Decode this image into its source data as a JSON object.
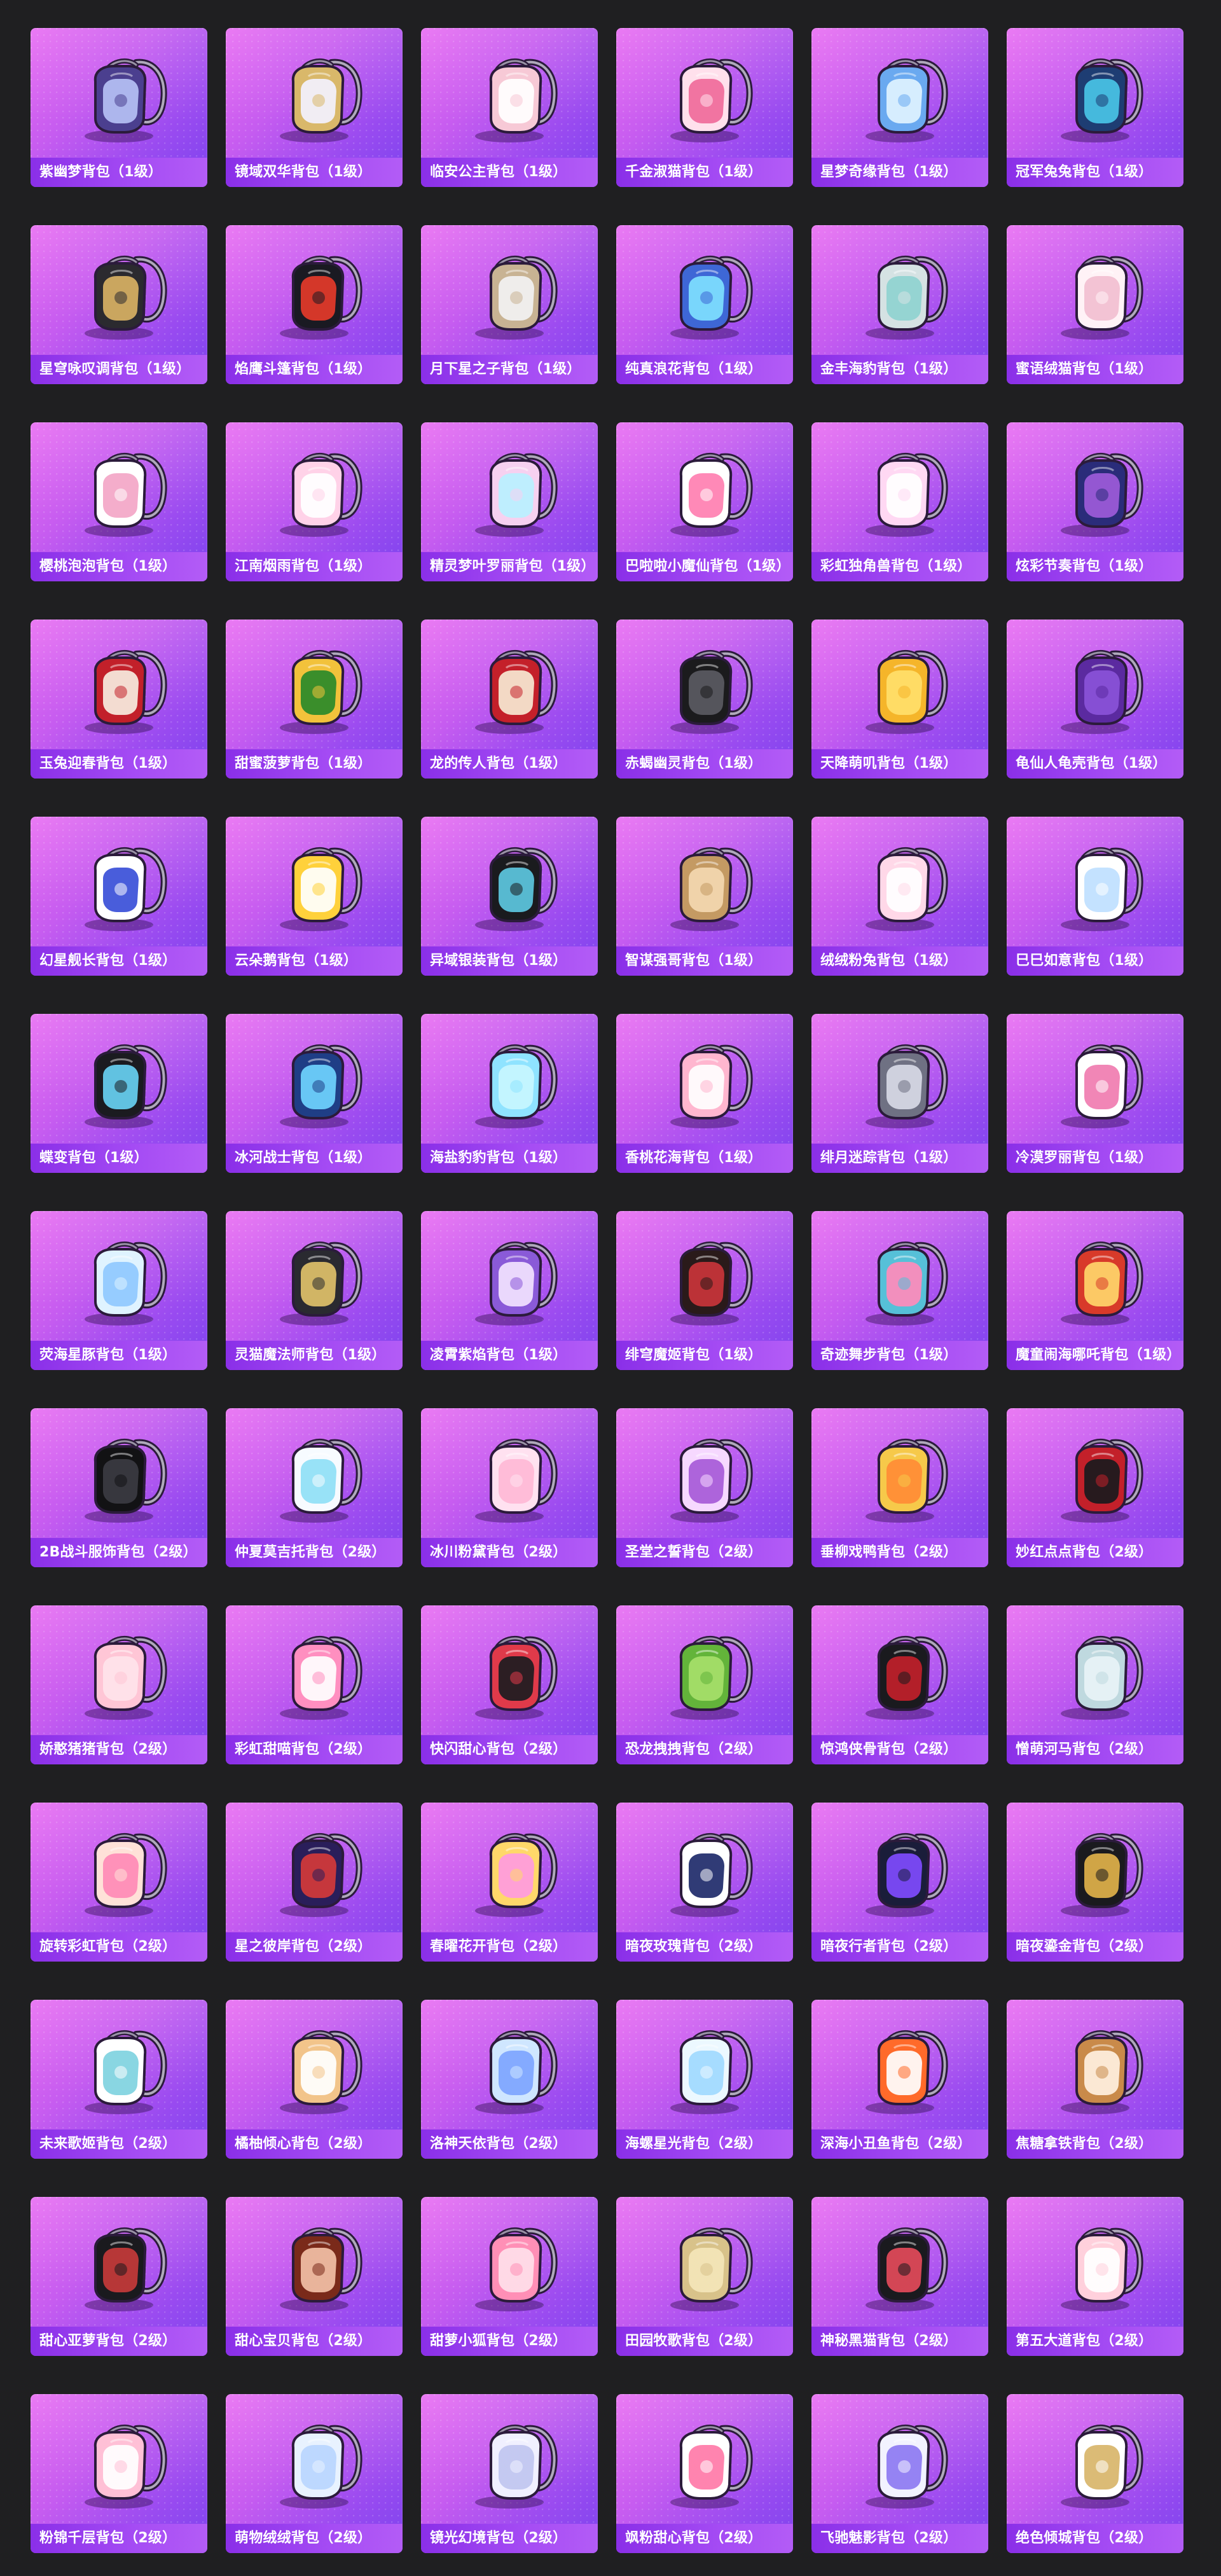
{
  "items": [
    {
      "name": "紫幽梦背包（1级）",
      "colors": [
        "#4b3f8f",
        "#b5c0f5"
      ]
    },
    {
      "name": "镜域双华背包（1级）",
      "colors": [
        "#d9b86a",
        "#f3f1ff"
      ]
    },
    {
      "name": "临安公主背包（1级）",
      "colors": [
        "#f7c9d6",
        "#ffffff"
      ]
    },
    {
      "name": "千金淑猫背包（1级）",
      "colors": [
        "#ffe0ec",
        "#f06a9a"
      ]
    },
    {
      "name": "星梦奇缘背包（1级）",
      "colors": [
        "#6aa9f0",
        "#dff3ff"
      ]
    },
    {
      "name": "冠军兔兔背包（1级）",
      "colors": [
        "#1e3d73",
        "#49c3e6"
      ]
    },
    {
      "name": "星穹咏叹调背包（1级）",
      "colors": [
        "#2b2a2f",
        "#d8b164"
      ]
    },
    {
      "name": "焰鹰斗篷背包（1级）",
      "colors": [
        "#1a1a22",
        "#e43a2a"
      ]
    },
    {
      "name": "月下星之子背包（1级）",
      "colors": [
        "#c8b393",
        "#f2f2f2"
      ]
    },
    {
      "name": "纯真浪花背包（1级）",
      "colors": [
        "#3e67d6",
        "#7ee0ff"
      ]
    },
    {
      "name": "金丰海豹背包（1级）",
      "colors": [
        "#d5e2e3",
        "#8fd3d0"
      ]
    },
    {
      "name": "蜜语绒猫背包（1级）",
      "colors": [
        "#fff2f6",
        "#f2bfd0"
      ]
    },
    {
      "name": "樱桃泡泡背包（1级）",
      "colors": [
        "#ffffff",
        "#f3a6c7"
      ]
    },
    {
      "name": "江南烟雨背包（1级）",
      "colors": [
        "#ffd2e8",
        "#ffffff"
      ]
    },
    {
      "name": "精灵梦叶罗丽背包（1级）",
      "colors": [
        "#f6d1f0",
        "#b9f0ff"
      ]
    },
    {
      "name": "巴啦啦小魔仙背包（1级）",
      "colors": [
        "#ffffff",
        "#ff7fb1"
      ]
    },
    {
      "name": "彩虹独角兽背包（1级）",
      "colors": [
        "#ffd8f3",
        "#ffffff"
      ]
    },
    {
      "name": "炫彩节奏背包（1级）",
      "colors": [
        "#2a2c7a",
        "#9d5bd9"
      ]
    },
    {
      "name": "玉兔迎春背包（1级）",
      "colors": [
        "#c2202a",
        "#f7ede0"
      ]
    },
    {
      "name": "甜蜜菠萝背包（1级）",
      "colors": [
        "#f2c23b",
        "#2a8a2a"
      ]
    },
    {
      "name": "龙的传人背包（1级）",
      "colors": [
        "#c4202a",
        "#f6e9d2"
      ]
    },
    {
      "name": "赤蝎幽灵背包（1级）",
      "colors": [
        "#1b1b1d",
        "#5a5a62"
      ]
    },
    {
      "name": "天降萌叽背包（1级）",
      "colors": [
        "#f5b52a",
        "#ffe06a"
      ]
    },
    {
      "name": "龟仙人龟壳背包（1级）",
      "colors": [
        "#5b2aa0",
        "#8a52d8"
      ]
    },
    {
      "name": "幻星舰长背包（1级）",
      "colors": [
        "#ffffff",
        "#3a4fd8"
      ]
    },
    {
      "name": "云朵鹅背包（1级）",
      "colors": [
        "#ffd13b",
        "#ffffff"
      ]
    },
    {
      "name": "异域银装背包（1级）",
      "colors": [
        "#1a1b1e",
        "#5cc7e0"
      ]
    },
    {
      "name": "智谋强哥背包（1级）",
      "colors": [
        "#c49a63",
        "#f3d8b0"
      ]
    },
    {
      "name": "绒绒粉兔背包（1级）",
      "colors": [
        "#ffd8e8",
        "#ffffff"
      ]
    },
    {
      "name": "巳巳如意背包（1级）",
      "colors": [
        "#ffffff",
        "#bfe0ff"
      ]
    },
    {
      "name": "蝶变背包（1级）",
      "colors": [
        "#1b1b20",
        "#67d0f2"
      ]
    },
    {
      "name": "冰河战士背包（1级）",
      "colors": [
        "#1f3e86",
        "#6fd3ff"
      ]
    },
    {
      "name": "海盐豹豹背包（1级）",
      "colors": [
        "#8fe3ff",
        "#c8f6ff"
      ]
    },
    {
      "name": "香桃花海背包（1级）",
      "colors": [
        "#ffb6cf",
        "#ffffff"
      ]
    },
    {
      "name": "绯月迷踪背包（1级）",
      "colors": [
        "#6f7183",
        "#d7d9e6"
      ]
    },
    {
      "name": "冷漠罗丽背包（1级）",
      "colors": [
        "#ffffff",
        "#f07cb0"
      ]
    },
    {
      "name": "荧海星豚背包（1级）",
      "colors": [
        "#dff3ff",
        "#8fc9ff"
      ]
    },
    {
      "name": "灵猫魔法师背包（1级）",
      "colors": [
        "#2a2a30",
        "#e0c16a"
      ]
    },
    {
      "name": "凌霄紫焰背包（1级）",
      "colors": [
        "#8a5ad8",
        "#f2e3ff"
      ]
    },
    {
      "name": "绯穹魔姬背包（1级）",
      "colors": [
        "#2a1a1a",
        "#c9343a"
      ]
    },
    {
      "name": "奇迹舞步背包（1级）",
      "colors": [
        "#56c0d8",
        "#ff8bbb"
      ]
    },
    {
      "name": "魔童闹海哪吒背包（1级）",
      "colors": [
        "#d83a2a",
        "#ffd66a"
      ]
    },
    {
      "name": "2B战斗服饰背包（2级）",
      "colors": [
        "#121214",
        "#3b3b42"
      ]
    },
    {
      "name": "仲夏莫吉托背包（2级）",
      "colors": [
        "#f7fbff",
        "#8fe0f6"
      ]
    },
    {
      "name": "冰川粉黛背包（2级）",
      "colors": [
        "#ffe1f0",
        "#ffb8d6"
      ]
    },
    {
      "name": "圣堂之誓背包（2级）",
      "colors": [
        "#f6d8ff",
        "#a65ad8"
      ]
    },
    {
      "name": "垂柳戏鸭背包（2级）",
      "colors": [
        "#f6c94a",
        "#ff8c35"
      ]
    },
    {
      "name": "妙红点点背包（2级）",
      "colors": [
        "#c3202a",
        "#1a1a1d"
      ]
    },
    {
      "name": "娇憨猪猪背包（2级）",
      "colors": [
        "#ffc6d6",
        "#ffe3ea"
      ]
    },
    {
      "name": "彩虹甜喵背包（2级）",
      "colors": [
        "#ff8fc0",
        "#ffffff"
      ]
    },
    {
      "name": "快闪甜心背包（2级）",
      "colors": [
        "#e03a4a",
        "#1c1c20"
      ]
    },
    {
      "name": "恐龙拽拽背包（2级）",
      "colors": [
        "#63b43a",
        "#a6e06a"
      ]
    },
    {
      "name": "惊鸿侠骨背包（2级）",
      "colors": [
        "#1a1a1e",
        "#c01f2a"
      ]
    },
    {
      "name": "憎萌河马背包（2级）",
      "colors": [
        "#bfd9df",
        "#e8f3f6"
      ]
    },
    {
      "name": "旋转彩虹背包（2级）",
      "colors": [
        "#ffe1d8",
        "#ff8ab6"
      ]
    },
    {
      "name": "星之彼岸背包（2级）",
      "colors": [
        "#2a1e5a",
        "#d43a3a"
      ]
    },
    {
      "name": "春曜花开背包（2级）",
      "colors": [
        "#ffd86a",
        "#ff9be0"
      ]
    },
    {
      "name": "暗夜玫瑰背包（2级）",
      "colors": [
        "#ffffff",
        "#1e2a6a"
      ]
    },
    {
      "name": "暗夜行者背包（2级）",
      "colors": [
        "#1a1d3a",
        "#7f4bff"
      ]
    },
    {
      "name": "暗夜鎏金背包（2级）",
      "colors": [
        "#1a1a1e",
        "#e0b14a"
      ]
    },
    {
      "name": "未来歌姬背包（2级）",
      "colors": [
        "#ffffff",
        "#7fd3e0"
      ]
    },
    {
      "name": "橘柚倾心背包（2级）",
      "colors": [
        "#f2c48a",
        "#ffffff"
      ]
    },
    {
      "name": "洛神天依背包（2级）",
      "colors": [
        "#cfe6ff",
        "#7ea5ff"
      ]
    },
    {
      "name": "海螺星光背包（2级）",
      "colors": [
        "#ecf8ff",
        "#9fd9ff"
      ]
    },
    {
      "name": "深海小丑鱼背包（2级）",
      "colors": [
        "#ff6a2a",
        "#ffffff"
      ]
    },
    {
      "name": "焦糖拿铁背包（2级）",
      "colors": [
        "#c98a4a",
        "#fff0e0"
      ]
    },
    {
      "name": "甜心亚萝背包（2级）",
      "colors": [
        "#1a1a1e",
        "#c43a3a"
      ]
    },
    {
      "name": "甜心宝贝背包（2级）",
      "colors": [
        "#7a2a1a",
        "#f2c0a6"
      ]
    },
    {
      "name": "甜萝小狐背包（2级）",
      "colors": [
        "#ff8fb6",
        "#ffe0ea"
      ]
    },
    {
      "name": "田园牧歌背包（2级）",
      "colors": [
        "#d8c28a",
        "#f4e6b8"
      ]
    },
    {
      "name": "神秘黑猫背包（2级）",
      "colors": [
        "#1a1a1e",
        "#e34a5a"
      ]
    },
    {
      "name": "第五大道背包（2级）",
      "colors": [
        "#ffd0dc",
        "#ffffff"
      ]
    },
    {
      "name": "粉锦千层背包（2级）",
      "colors": [
        "#ffc0d6",
        "#ffffff"
      ]
    },
    {
      "name": "萌物绒绒背包（2级）",
      "colors": [
        "#e8f2ff",
        "#b9d6ff"
      ]
    },
    {
      "name": "镜光幻境背包（2级）",
      "colors": [
        "#f0f0ff",
        "#c0c6f0"
      ]
    },
    {
      "name": "飒粉甜心背包（2级）",
      "colors": [
        "#ffffff",
        "#ff7aa8"
      ]
    },
    {
      "name": "飞驰魅影背包（2级）",
      "colors": [
        "#f2f2ff",
        "#8d7af2"
      ]
    },
    {
      "name": "绝色倾城背包（2级）",
      "colors": [
        "#ffffff",
        "#d8b56a"
      ]
    }
  ]
}
